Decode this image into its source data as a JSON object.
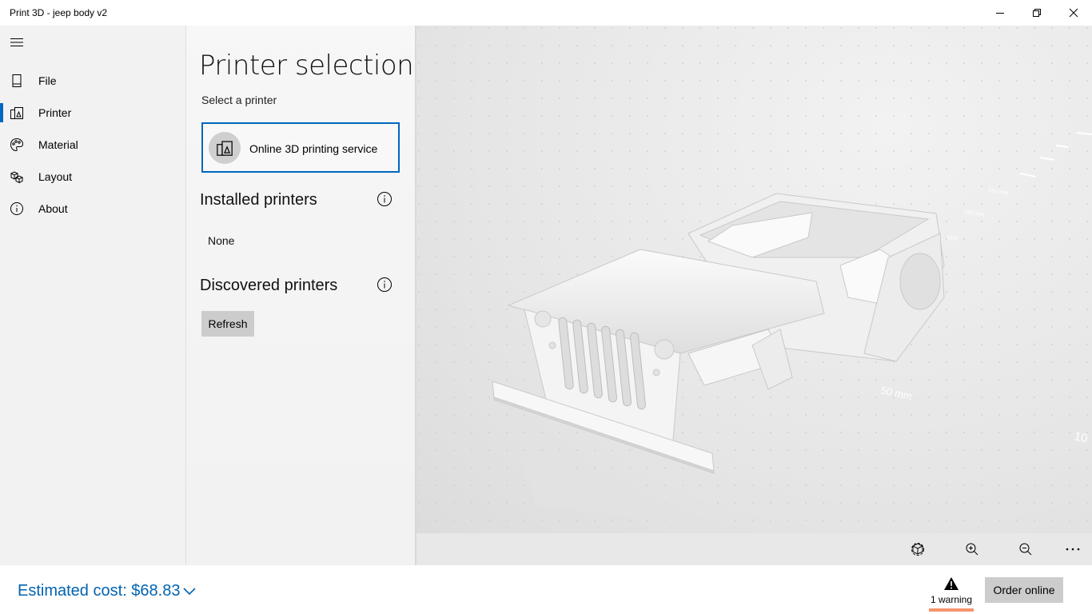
{
  "window": {
    "title": "Print 3D -  jeep body v2"
  },
  "nav": {
    "items": [
      {
        "label": "File",
        "icon": "file-icon"
      },
      {
        "label": "Printer",
        "icon": "printer-icon",
        "active": true
      },
      {
        "label": "Material",
        "icon": "palette-icon"
      },
      {
        "label": "Layout",
        "icon": "cubes-icon"
      },
      {
        "label": "About",
        "icon": "info-icon"
      }
    ]
  },
  "panel": {
    "title": "Printer selection",
    "select_label": "Select a printer",
    "online_service": "Online 3D printing service",
    "installed_heading": "Installed printers",
    "installed_none": "None",
    "discovered_heading": "Discovered printers",
    "refresh_label": "Refresh"
  },
  "viewport": {
    "scale_labels": [
      "50 mm",
      "10",
      "200 mm",
      "250 mm",
      "mm"
    ],
    "model": "jeep body"
  },
  "toolbar": {
    "buttons": [
      "view-3d-icon",
      "zoom-in-icon",
      "zoom-out-icon",
      "more-icon"
    ]
  },
  "footer": {
    "estimated_cost": "Estimated cost: $68.83",
    "warning_label": "1 warning",
    "order_label": "Order online"
  },
  "colors": {
    "accent": "#0067c0",
    "cost_text": "#0063b1",
    "warning_bar": "#f7946d"
  }
}
